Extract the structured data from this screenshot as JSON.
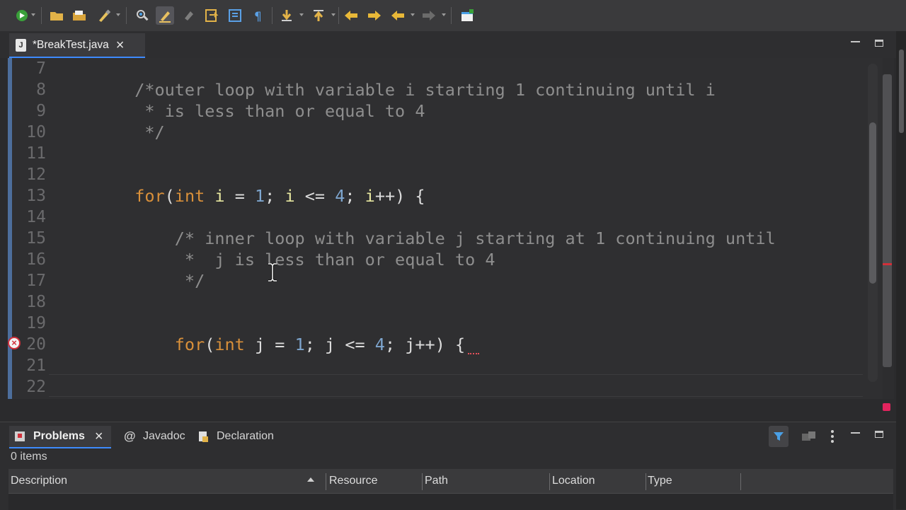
{
  "toolbar": {
    "icons": [
      "run-icon",
      "open-folder-icon",
      "open-file-icon",
      "brush-icon",
      "search-type-icon",
      "highlight-icon",
      "marker-icon",
      "annotation-icon",
      "block-selection-icon",
      "paragraph-icon",
      "next-annotation-icon",
      "prev-annotation-icon",
      "back-icon",
      "forward-icon",
      "nav-back-icon",
      "nav-forward-icon",
      "open-perspective-icon"
    ]
  },
  "editor": {
    "tab_label": "*BreakTest.java",
    "file_icon_letter": "J",
    "lines": [
      {
        "n": "7",
        "tokens": []
      },
      {
        "n": "8",
        "tokens": [
          {
            "t": "cm",
            "v": "/*outer loop with variable i starting 1 continuing until i"
          }
        ],
        "indent": "        "
      },
      {
        "n": "9",
        "tokens": [
          {
            "t": "cm",
            "v": " * is less than or equal to 4"
          }
        ],
        "indent": "        "
      },
      {
        "n": "10",
        "tokens": [
          {
            "t": "cm",
            "v": " */"
          }
        ],
        "indent": "        "
      },
      {
        "n": "11",
        "tokens": []
      },
      {
        "n": "12",
        "tokens": []
      },
      {
        "n": "13",
        "tokens": [
          {
            "t": "kw",
            "v": "for"
          },
          {
            "t": "plain",
            "v": "("
          },
          {
            "t": "kw",
            "v": "int"
          },
          {
            "t": "plain",
            "v": " "
          },
          {
            "t": "ivar",
            "v": "i"
          },
          {
            "t": "plain",
            "v": " = "
          },
          {
            "t": "num",
            "v": "1"
          },
          {
            "t": "plain",
            "v": "; "
          },
          {
            "t": "ivar",
            "v": "i"
          },
          {
            "t": "plain",
            "v": " <= "
          },
          {
            "t": "num",
            "v": "4"
          },
          {
            "t": "plain",
            "v": "; "
          },
          {
            "t": "ivar",
            "v": "i"
          },
          {
            "t": "plain",
            "v": "++) {"
          }
        ],
        "indent": "        "
      },
      {
        "n": "14",
        "tokens": []
      },
      {
        "n": "15",
        "tokens": [
          {
            "t": "cm",
            "v": "/* inner loop with variable j starting at 1 continuing until"
          }
        ],
        "indent": "            "
      },
      {
        "n": "16",
        "tokens": [
          {
            "t": "cm",
            "v": " *  j is less than or equal to 4"
          }
        ],
        "indent": "            "
      },
      {
        "n": "17",
        "tokens": [
          {
            "t": "cm",
            "v": " */"
          }
        ],
        "indent": "            "
      },
      {
        "n": "18",
        "tokens": []
      },
      {
        "n": "19",
        "tokens": []
      },
      {
        "n": "20",
        "tokens": [
          {
            "t": "kw",
            "v": "for"
          },
          {
            "t": "plain",
            "v": "("
          },
          {
            "t": "kw",
            "v": "int"
          },
          {
            "t": "plain",
            "v": " j = "
          },
          {
            "t": "num",
            "v": "1"
          },
          {
            "t": "plain",
            "v": "; j <= "
          },
          {
            "t": "num",
            "v": "4"
          },
          {
            "t": "plain",
            "v": "; j++) {"
          }
        ],
        "indent": "            "
      },
      {
        "n": "21",
        "tokens": []
      },
      {
        "n": "22",
        "tokens": []
      }
    ],
    "error_line": "20"
  },
  "panel": {
    "tabs": [
      "Problems",
      "Javadoc",
      "Declaration"
    ],
    "items_count": "0 items",
    "columns": [
      "Description",
      "Resource",
      "Path",
      "Location",
      "Type"
    ]
  }
}
